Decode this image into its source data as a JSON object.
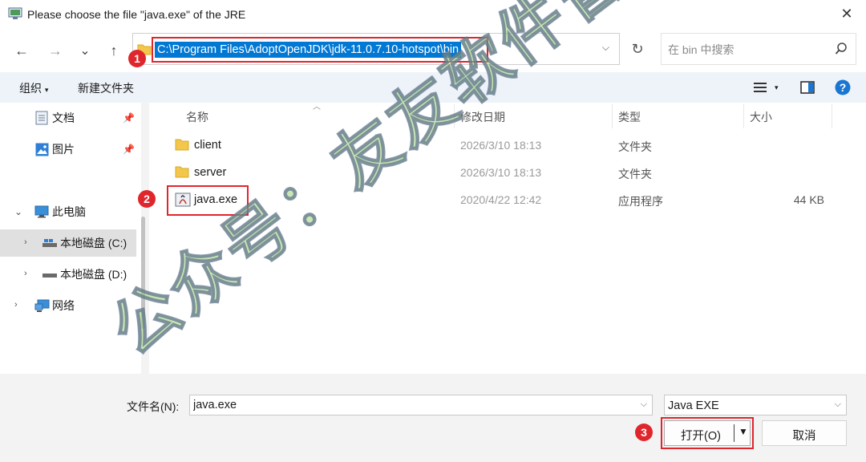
{
  "window": {
    "title": "Please choose the file \"java.exe\" of the JRE",
    "close_glyph": "✕"
  },
  "navigation": {
    "back_glyph": "←",
    "forward_glyph": "→",
    "history_glyph": "⌄",
    "up_glyph": "↑",
    "address_path": "C:\\Program Files\\AdoptOpenJDK\\jdk-11.0.7.10-hotspot\\bin",
    "refresh_glyph": "↻",
    "search_placeholder": "在 bin 中搜索"
  },
  "steps": {
    "step1": "1",
    "step2": "2",
    "step3": "3"
  },
  "commandbar": {
    "organize": "组织",
    "new_folder": "新建文件夹"
  },
  "sidebar": {
    "items": [
      {
        "label": "文档",
        "pinned": true
      },
      {
        "label": "图片",
        "pinned": true
      },
      {
        "label": "此电脑"
      },
      {
        "label": "本地磁盘 (C:)"
      },
      {
        "label": "本地磁盘 (D:)"
      },
      {
        "label": "网络"
      }
    ]
  },
  "filelist": {
    "columns": {
      "name": "名称",
      "modified": "修改日期",
      "type": "类型",
      "size": "大小"
    },
    "rows": [
      {
        "name": "client",
        "modified": "2026/3/10 18:13",
        "type": "文件夹",
        "size": ""
      },
      {
        "name": "server",
        "modified": "2026/3/10 18:13",
        "type": "文件夹",
        "size": ""
      },
      {
        "name": "java.exe",
        "modified": "2020/4/22 12:42",
        "type": "应用程序",
        "size": "44 KB"
      }
    ]
  },
  "footer": {
    "filename_label": "文件名(N):",
    "filename_value": "java.exe",
    "filetype_value": "Java EXE",
    "open_label": "打开(O)",
    "cancel_label": "取消"
  },
  "watermark": {
    "text": "公众号：友友软件管家"
  },
  "colors": {
    "selection": "#0078d4",
    "highlight_red": "#e0262d",
    "folder_yellow": "#f3c74b",
    "help_blue": "#1976d2"
  }
}
